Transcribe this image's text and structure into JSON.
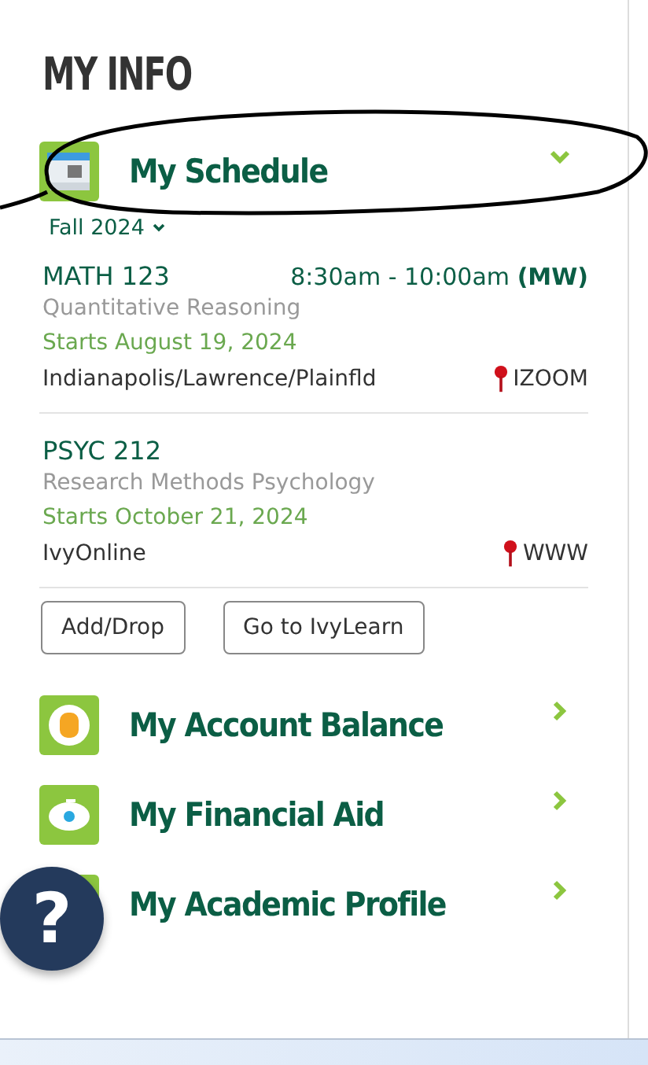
{
  "heading": "MY INFO",
  "schedule": {
    "title": "My Schedule",
    "expanded": true,
    "term": "Fall 2024",
    "courses": [
      {
        "code": "MATH 123",
        "time": "8:30am - 10:00am **(MW)**",
        "name": "Quantitative Reasoning",
        "starts": "Starts August 19, 2024",
        "campus": "Indianapolis/Lawrence/Plainfld",
        "room": "IZOOM"
      },
      {
        "code": "PSYC 212",
        "name": "Research Methods Psychology",
        "starts": "Starts October 21, 2024",
        "campus": "IvyOnline",
        "room": "WWW"
      }
    ],
    "buttons": [
      "Add/Drop",
      "Go to IvyLearn"
    ]
  },
  "sections": [
    {
      "title": "My Account Balance",
      "expanded": false
    },
    {
      "title": "My Financial Aid",
      "expanded": false
    },
    {
      "title": "My Academic Profile",
      "expanded": false
    }
  ],
  "help_button": "?"
}
